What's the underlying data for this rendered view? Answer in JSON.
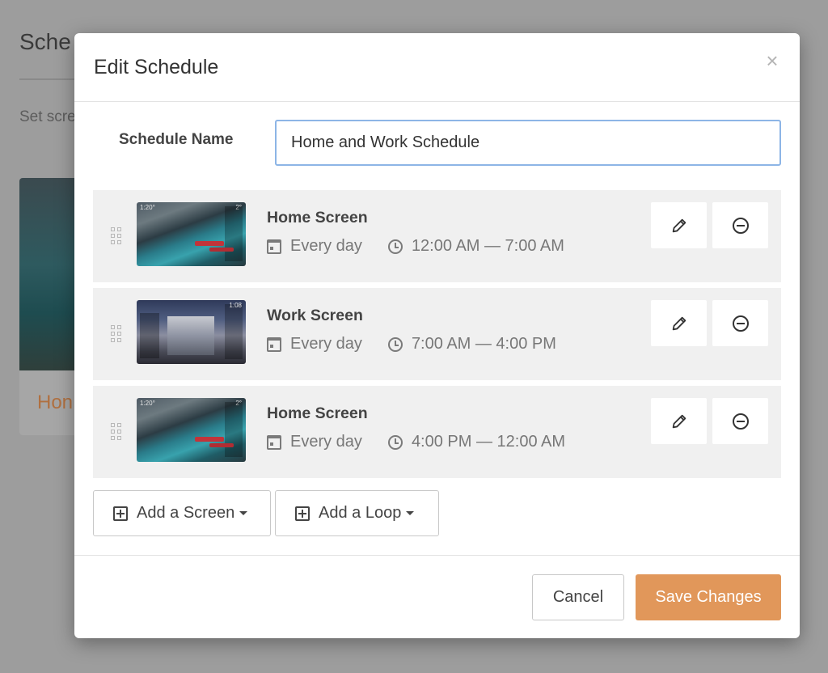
{
  "background": {
    "title": "Sche",
    "subtitle": "Set scre",
    "card_label": "Hon"
  },
  "modal": {
    "title": "Edit Schedule",
    "close_glyph": "×",
    "schedule_name_label": "Schedule Name",
    "schedule_name_value": "Home and Work Schedule",
    "rows": [
      {
        "title": "Home Screen",
        "frequency": "Every day",
        "time_range": "12:00 AM — 7:00 AM",
        "thumbnail": "home",
        "thumb_time": "1:20°",
        "thumb_time_r": "2°"
      },
      {
        "title": "Work Screen",
        "frequency": "Every day",
        "time_range": "7:00 AM — 4:00 PM",
        "thumbnail": "work",
        "thumb_time": "",
        "thumb_time_r": "1:08"
      },
      {
        "title": "Home Screen",
        "frequency": "Every day",
        "time_range": "4:00 PM — 12:00 AM",
        "thumbnail": "home",
        "thumb_time": "1:20°",
        "thumb_time_r": "2°"
      }
    ],
    "add_screen_label": "Add a Screen",
    "add_loop_label": "Add a Loop",
    "cancel_label": "Cancel",
    "save_label": "Save Changes"
  },
  "colors": {
    "accent": "#e1975a",
    "input_focus": "#8db5e6",
    "row_bg": "#f0f0f0"
  }
}
